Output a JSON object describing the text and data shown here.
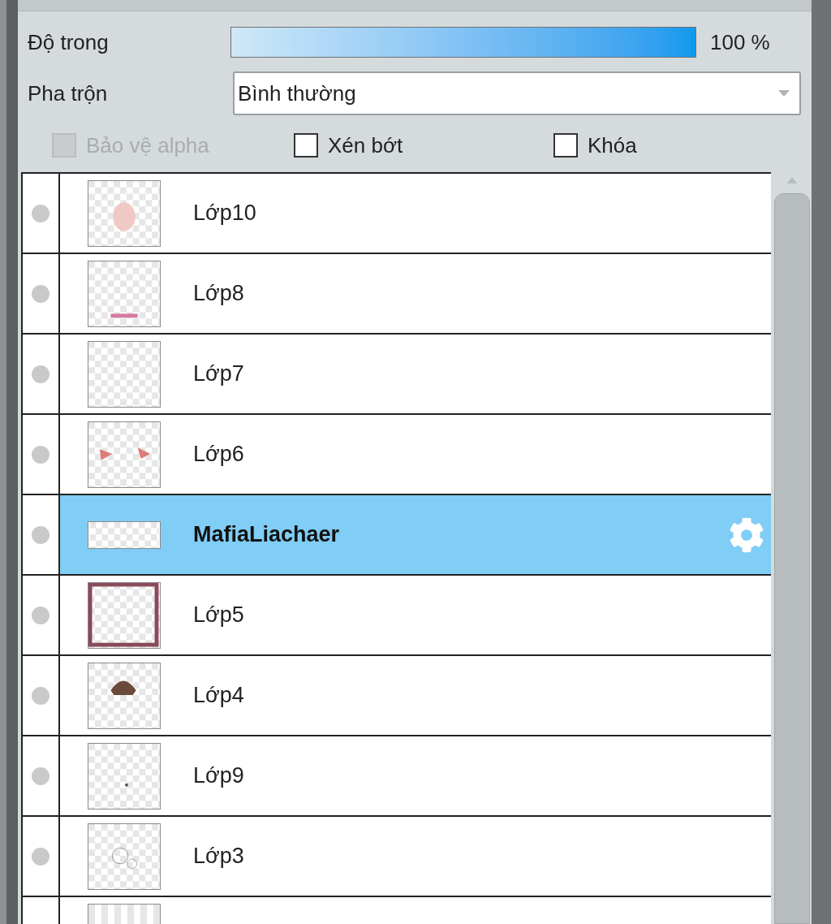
{
  "opacity": {
    "label": "Độ trong",
    "level": 1,
    "reading": "100 %"
  },
  "blend": {
    "label": "Pha trộn",
    "value": "Bình thường"
  },
  "options": [
    {
      "label": "Bảo vệ alpha",
      "checked": false,
      "disabled": true
    },
    {
      "label": "Xén bớt",
      "checked": false,
      "disabled": false
    },
    {
      "label": "Khóa",
      "checked": false,
      "disabled": false
    }
  ],
  "layers": [
    {
      "name": "Lớp10",
      "selected": false
    },
    {
      "name": "Lớp8",
      "selected": false
    },
    {
      "name": "Lớp7",
      "selected": false
    },
    {
      "name": "Lớp6",
      "selected": false
    },
    {
      "name": "MafiaLiachaer",
      "selected": true
    },
    {
      "name": "Lớp5",
      "selected": false
    },
    {
      "name": "Lớp4",
      "selected": false
    },
    {
      "name": "Lớp9",
      "selected": false
    },
    {
      "name": "Lớp3",
      "selected": false
    }
  ]
}
